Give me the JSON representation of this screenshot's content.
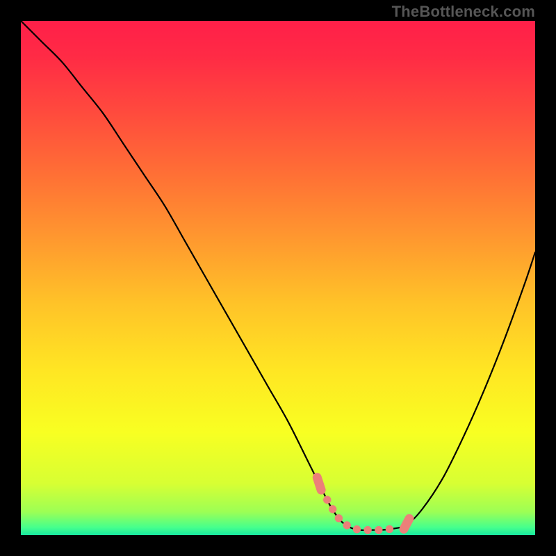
{
  "watermark": {
    "text": "TheBottleneck.com"
  },
  "gradient": {
    "stops": [
      {
        "offset": 0.0,
        "color": "#ff1f49"
      },
      {
        "offset": 0.07,
        "color": "#ff2b45"
      },
      {
        "offset": 0.18,
        "color": "#ff4b3d"
      },
      {
        "offset": 0.3,
        "color": "#ff7035"
      },
      {
        "offset": 0.42,
        "color": "#ff972f"
      },
      {
        "offset": 0.55,
        "color": "#ffc328"
      },
      {
        "offset": 0.68,
        "color": "#ffe623"
      },
      {
        "offset": 0.8,
        "color": "#f8ff22"
      },
      {
        "offset": 0.9,
        "color": "#d7ff33"
      },
      {
        "offset": 0.955,
        "color": "#9cff55"
      },
      {
        "offset": 0.985,
        "color": "#46ff8d"
      },
      {
        "offset": 1.0,
        "color": "#18e8a0"
      }
    ]
  },
  "chart_data": {
    "type": "line",
    "title": "",
    "xlabel": "",
    "ylabel": "",
    "xlim": [
      0,
      100
    ],
    "ylim": [
      0,
      100
    ],
    "series": [
      {
        "name": "bottleneck-curve",
        "color": "#000000",
        "x": [
          0,
          4,
          8,
          12,
          16,
          20,
          24,
          28,
          32,
          36,
          40,
          44,
          48,
          52,
          56,
          58,
          60,
          62,
          64,
          66,
          68,
          70,
          72,
          75,
          78,
          82,
          86,
          90,
          94,
          98,
          100
        ],
        "y": [
          100,
          96,
          92,
          87,
          82,
          76,
          70,
          64,
          57,
          50,
          43,
          36,
          29,
          22,
          14,
          10,
          6,
          3,
          1.5,
          1,
          1,
          1,
          1.2,
          2,
          5,
          11,
          19,
          28,
          38,
          49,
          55
        ]
      },
      {
        "name": "valley-highlight",
        "color": "#ec8079",
        "style": "dotted-cap",
        "x": [
          58,
          60,
          62,
          63,
          64,
          65,
          66,
          67,
          68,
          69,
          70,
          71,
          72,
          73,
          74,
          75
        ],
        "y": [
          10,
          6,
          3,
          2.2,
          1.5,
          1.2,
          1,
          1,
          1,
          1,
          1,
          1.1,
          1.2,
          1.5,
          1.8,
          2.2
        ]
      }
    ]
  }
}
